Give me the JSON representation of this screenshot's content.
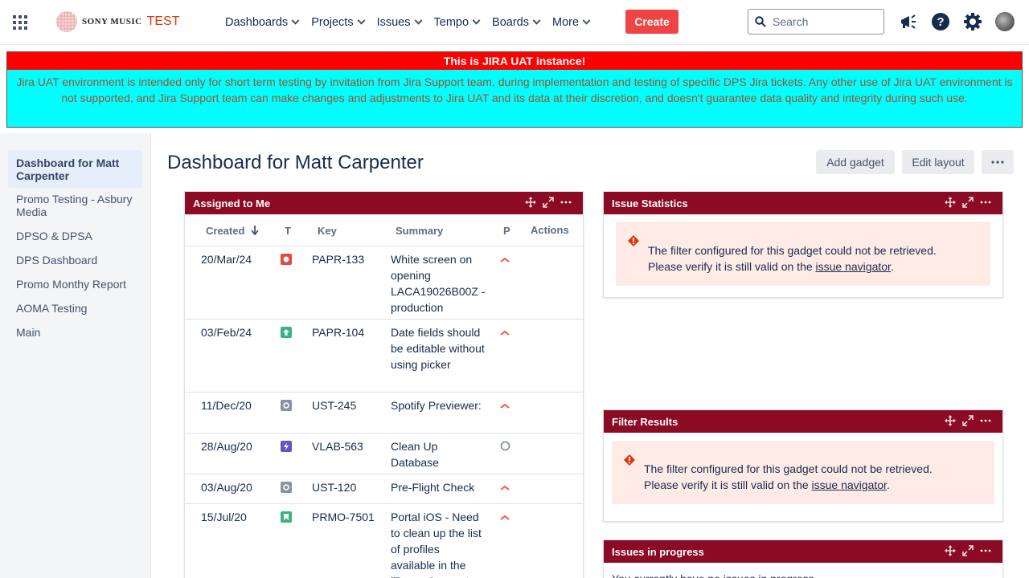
{
  "brand": {
    "name": "SONY MUSIC",
    "env": "TEST"
  },
  "nav": {
    "items": [
      "Dashboards",
      "Projects",
      "Issues",
      "Tempo",
      "Boards",
      "More"
    ],
    "create": "Create",
    "search_placeholder": "Search"
  },
  "banner": {
    "title": "This is JIRA UAT instance!",
    "body": "Jira UAT environment is intended only for short term testing by invitation from Jira Support team, during implementation and testing of specific DPS Jira tickets. Any other use of Jira UAT environment is not supported, and Jira Support team can make changes and adjustments to Jira UAT and its data at their discretion, and doesn't guarantee data quality and integrity during such use."
  },
  "sidebar": {
    "items": [
      "Dashboard for Matt Carpenter",
      "Promo Testing - Asbury Media",
      "DPSO & DPSA",
      "DPS Dashboard",
      "Promo Monthy Report",
      "AOMA Testing",
      "Main"
    ]
  },
  "page": {
    "title": "Dashboard for Matt Carpenter",
    "add_gadget": "Add gadget",
    "edit_layout": "Edit layout"
  },
  "assigned": {
    "title": "Assigned to Me",
    "columns": {
      "created": "Created",
      "type": "T",
      "key": "Key",
      "summary": "Summary",
      "priority": "P",
      "actions": "Actions"
    },
    "rows": [
      {
        "created": "20/Mar/24",
        "type": "bug",
        "key": "PAPR-133",
        "summary": "White screen on opening LACA19026B00Z - production",
        "priority": "high"
      },
      {
        "created": "03/Feb/24",
        "type": "improvement",
        "key": "PAPR-104",
        "summary": "Date fields should be editable without using picker",
        "priority": "high"
      },
      {
        "created": "11/Dec/20",
        "type": "task",
        "key": "UST-245",
        "summary": "Spotify Previewer:",
        "priority": "high"
      },
      {
        "created": "28/Aug/20",
        "type": "epic",
        "key": "VLAB-563",
        "summary": "Clean Up Database",
        "priority": "none"
      },
      {
        "created": "03/Aug/20",
        "type": "task",
        "key": "UST-120",
        "summary": "Pre-Flight Check",
        "priority": "high"
      },
      {
        "created": "15/Jul/20",
        "type": "story",
        "key": "PRMO-7501",
        "summary": "Portal iOS - Need to clean up the list of profiles available in the iTunes Connect",
        "priority": "high"
      }
    ]
  },
  "issue_stats": {
    "title": "Issue Statistics",
    "error_line1": "The filter configured for this gadget could not be retrieved.",
    "error_line2": "Please verify it is still valid on the",
    "link": "issue navigator",
    "period": "."
  },
  "filter_results": {
    "title": "Filter Results",
    "error_line1": "The filter configured for this gadget could not be retrieved.",
    "error_line2": "Please verify it is still valid on the",
    "link": "issue navigator",
    "period": "."
  },
  "in_progress": {
    "title": "Issues in progress",
    "message": "You currently have no issues in progress."
  },
  "colors": {
    "gadget_header": "#8b0a24",
    "create": "#ef4444",
    "banner_red": "#ff0000",
    "banner_cyan": "#00ffff"
  }
}
